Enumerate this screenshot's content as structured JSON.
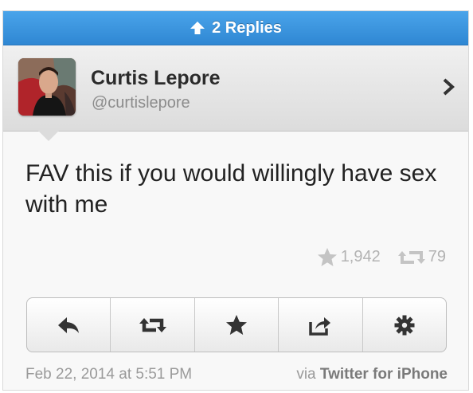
{
  "replies": {
    "label": "2 Replies",
    "icon": "arrow-up-icon"
  },
  "user": {
    "display_name": "Curtis Lepore",
    "handle": "@curtislepore",
    "avatar_icon": "user-avatar"
  },
  "tweet": {
    "text": "FAV this if you would willingly have sex with me",
    "favorites": "1,942",
    "retweets": "79"
  },
  "actions": [
    {
      "name": "reply-icon"
    },
    {
      "name": "retweet-icon"
    },
    {
      "name": "star-icon"
    },
    {
      "name": "share-icon"
    },
    {
      "name": "gear-icon"
    }
  ],
  "meta": {
    "timestamp": "Feb 22, 2014 at 5:51 PM",
    "via_prefix": "via",
    "source": "Twitter for iPhone"
  },
  "colors": {
    "header_blue": "#3597e0",
    "text_dark": "#222222",
    "muted": "#9a9a9a"
  }
}
